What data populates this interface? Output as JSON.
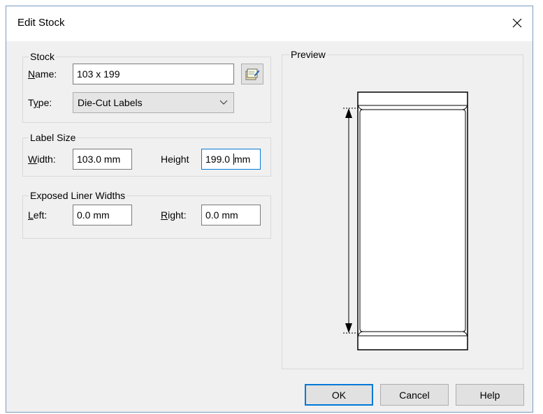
{
  "dialog": {
    "title": "Edit Stock"
  },
  "stock": {
    "group_label": "Stock",
    "name_label_accel": "N",
    "name_label_rest": "ame:",
    "name_value": "103 x 199",
    "type_label_pre": "T",
    "type_label_accel": "y",
    "type_label_rest": "pe:",
    "type_value": "Die-Cut Labels"
  },
  "label_size": {
    "group_label": "Label Size",
    "width_label_accel": "W",
    "width_label_rest": "idth:",
    "width_value": "103.0 mm",
    "height_label": "Height",
    "height_value_before_caret": "199.0 ",
    "height_value_after_caret": "mm"
  },
  "liner": {
    "group_label": "Exposed Liner Widths",
    "left_label_accel": "L",
    "left_label_rest": "eft:",
    "left_value": "0.0 mm",
    "right_label_accel": "R",
    "right_label_rest": "ight:",
    "right_value": "0.0 mm"
  },
  "preview": {
    "group_label": "Preview"
  },
  "buttons": {
    "ok": "OK",
    "cancel": "Cancel",
    "help": "Help"
  },
  "icons": {
    "close": "close-icon",
    "stock_picker": "stock-properties-icon",
    "dropdown": "chevron-down-icon"
  },
  "colors": {
    "accent": "#0078d7",
    "dialog_bg": "#f0f0f0"
  }
}
